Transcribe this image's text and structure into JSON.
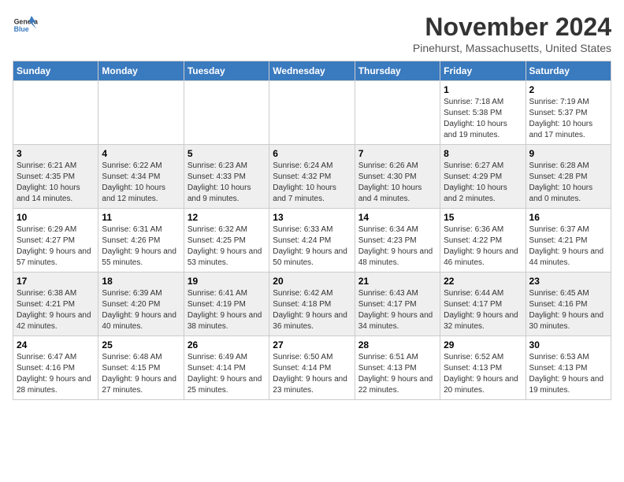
{
  "logo": {
    "general": "General",
    "blue": "Blue"
  },
  "title": "November 2024",
  "subtitle": "Pinehurst, Massachusetts, United States",
  "days_of_week": [
    "Sunday",
    "Monday",
    "Tuesday",
    "Wednesday",
    "Thursday",
    "Friday",
    "Saturday"
  ],
  "weeks": [
    [
      {
        "day": "",
        "detail": ""
      },
      {
        "day": "",
        "detail": ""
      },
      {
        "day": "",
        "detail": ""
      },
      {
        "day": "",
        "detail": ""
      },
      {
        "day": "",
        "detail": ""
      },
      {
        "day": "1",
        "detail": "Sunrise: 7:18 AM\nSunset: 5:38 PM\nDaylight: 10 hours and 19 minutes."
      },
      {
        "day": "2",
        "detail": "Sunrise: 7:19 AM\nSunset: 5:37 PM\nDaylight: 10 hours and 17 minutes."
      }
    ],
    [
      {
        "day": "3",
        "detail": "Sunrise: 6:21 AM\nSunset: 4:35 PM\nDaylight: 10 hours and 14 minutes."
      },
      {
        "day": "4",
        "detail": "Sunrise: 6:22 AM\nSunset: 4:34 PM\nDaylight: 10 hours and 12 minutes."
      },
      {
        "day": "5",
        "detail": "Sunrise: 6:23 AM\nSunset: 4:33 PM\nDaylight: 10 hours and 9 minutes."
      },
      {
        "day": "6",
        "detail": "Sunrise: 6:24 AM\nSunset: 4:32 PM\nDaylight: 10 hours and 7 minutes."
      },
      {
        "day": "7",
        "detail": "Sunrise: 6:26 AM\nSunset: 4:30 PM\nDaylight: 10 hours and 4 minutes."
      },
      {
        "day": "8",
        "detail": "Sunrise: 6:27 AM\nSunset: 4:29 PM\nDaylight: 10 hours and 2 minutes."
      },
      {
        "day": "9",
        "detail": "Sunrise: 6:28 AM\nSunset: 4:28 PM\nDaylight: 10 hours and 0 minutes."
      }
    ],
    [
      {
        "day": "10",
        "detail": "Sunrise: 6:29 AM\nSunset: 4:27 PM\nDaylight: 9 hours and 57 minutes."
      },
      {
        "day": "11",
        "detail": "Sunrise: 6:31 AM\nSunset: 4:26 PM\nDaylight: 9 hours and 55 minutes."
      },
      {
        "day": "12",
        "detail": "Sunrise: 6:32 AM\nSunset: 4:25 PM\nDaylight: 9 hours and 53 minutes."
      },
      {
        "day": "13",
        "detail": "Sunrise: 6:33 AM\nSunset: 4:24 PM\nDaylight: 9 hours and 50 minutes."
      },
      {
        "day": "14",
        "detail": "Sunrise: 6:34 AM\nSunset: 4:23 PM\nDaylight: 9 hours and 48 minutes."
      },
      {
        "day": "15",
        "detail": "Sunrise: 6:36 AM\nSunset: 4:22 PM\nDaylight: 9 hours and 46 minutes."
      },
      {
        "day": "16",
        "detail": "Sunrise: 6:37 AM\nSunset: 4:21 PM\nDaylight: 9 hours and 44 minutes."
      }
    ],
    [
      {
        "day": "17",
        "detail": "Sunrise: 6:38 AM\nSunset: 4:21 PM\nDaylight: 9 hours and 42 minutes."
      },
      {
        "day": "18",
        "detail": "Sunrise: 6:39 AM\nSunset: 4:20 PM\nDaylight: 9 hours and 40 minutes."
      },
      {
        "day": "19",
        "detail": "Sunrise: 6:41 AM\nSunset: 4:19 PM\nDaylight: 9 hours and 38 minutes."
      },
      {
        "day": "20",
        "detail": "Sunrise: 6:42 AM\nSunset: 4:18 PM\nDaylight: 9 hours and 36 minutes."
      },
      {
        "day": "21",
        "detail": "Sunrise: 6:43 AM\nSunset: 4:17 PM\nDaylight: 9 hours and 34 minutes."
      },
      {
        "day": "22",
        "detail": "Sunrise: 6:44 AM\nSunset: 4:17 PM\nDaylight: 9 hours and 32 minutes."
      },
      {
        "day": "23",
        "detail": "Sunrise: 6:45 AM\nSunset: 4:16 PM\nDaylight: 9 hours and 30 minutes."
      }
    ],
    [
      {
        "day": "24",
        "detail": "Sunrise: 6:47 AM\nSunset: 4:16 PM\nDaylight: 9 hours and 28 minutes."
      },
      {
        "day": "25",
        "detail": "Sunrise: 6:48 AM\nSunset: 4:15 PM\nDaylight: 9 hours and 27 minutes."
      },
      {
        "day": "26",
        "detail": "Sunrise: 6:49 AM\nSunset: 4:14 PM\nDaylight: 9 hours and 25 minutes."
      },
      {
        "day": "27",
        "detail": "Sunrise: 6:50 AM\nSunset: 4:14 PM\nDaylight: 9 hours and 23 minutes."
      },
      {
        "day": "28",
        "detail": "Sunrise: 6:51 AM\nSunset: 4:13 PM\nDaylight: 9 hours and 22 minutes."
      },
      {
        "day": "29",
        "detail": "Sunrise: 6:52 AM\nSunset: 4:13 PM\nDaylight: 9 hours and 20 minutes."
      },
      {
        "day": "30",
        "detail": "Sunrise: 6:53 AM\nSunset: 4:13 PM\nDaylight: 9 hours and 19 minutes."
      }
    ]
  ]
}
